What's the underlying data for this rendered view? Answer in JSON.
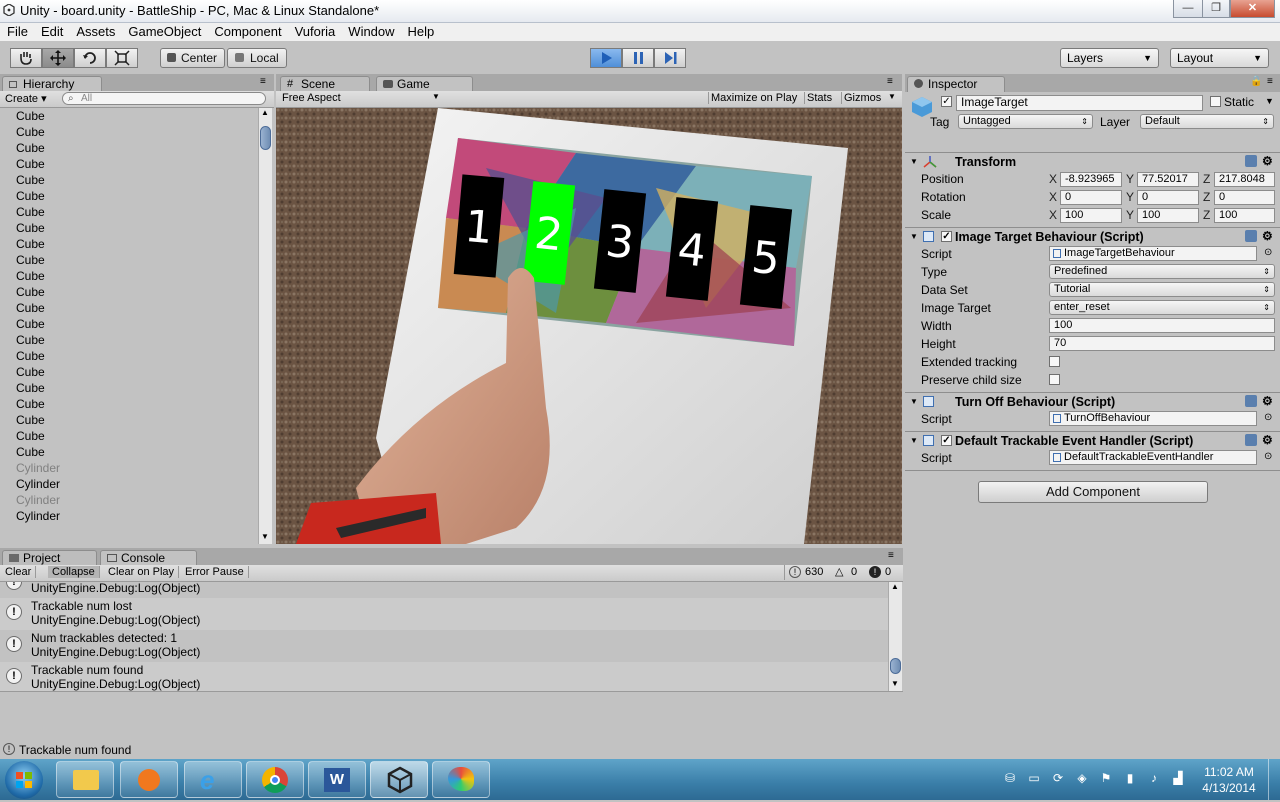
{
  "window": {
    "title": "Unity - board.unity - BattleShip - PC, Mac & Linux Standalone*",
    "min": "—",
    "max": "❐",
    "close": "✕"
  },
  "menu": [
    "File",
    "Edit",
    "Assets",
    "GameObject",
    "Component",
    "Vuforia",
    "Window",
    "Help"
  ],
  "toolbar": {
    "pivot": "Center",
    "space": "Local",
    "layers": "Layers",
    "layout": "Layout"
  },
  "hierarchy": {
    "tab": "Hierarchy",
    "create": "Create",
    "search_placeholder": "All",
    "items": [
      {
        "name": "Cube",
        "muted": false
      },
      {
        "name": "Cube",
        "muted": false
      },
      {
        "name": "Cube",
        "muted": false
      },
      {
        "name": "Cube",
        "muted": false
      },
      {
        "name": "Cube",
        "muted": false
      },
      {
        "name": "Cube",
        "muted": false
      },
      {
        "name": "Cube",
        "muted": false
      },
      {
        "name": "Cube",
        "muted": false
      },
      {
        "name": "Cube",
        "muted": false
      },
      {
        "name": "Cube",
        "muted": false
      },
      {
        "name": "Cube",
        "muted": false
      },
      {
        "name": "Cube",
        "muted": false
      },
      {
        "name": "Cube",
        "muted": false
      },
      {
        "name": "Cube",
        "muted": false
      },
      {
        "name": "Cube",
        "muted": false
      },
      {
        "name": "Cube",
        "muted": false
      },
      {
        "name": "Cube",
        "muted": false
      },
      {
        "name": "Cube",
        "muted": false
      },
      {
        "name": "Cube",
        "muted": false
      },
      {
        "name": "Cube",
        "muted": false
      },
      {
        "name": "Cube",
        "muted": false
      },
      {
        "name": "Cube",
        "muted": false
      },
      {
        "name": "Cylinder",
        "muted": true
      },
      {
        "name": "Cylinder",
        "muted": false
      },
      {
        "name": "Cylinder",
        "muted": true
      },
      {
        "name": "Cylinder",
        "muted": false
      }
    ]
  },
  "scene_tab": "Scene",
  "game": {
    "tab": "Game",
    "aspect": "Free Aspect",
    "maximize": "Maximize on Play",
    "stats": "Stats",
    "gizmos": "Gizmos",
    "buttons": [
      {
        "label": "1",
        "color": "#000000",
        "text_color": "#ffffff"
      },
      {
        "label": "2",
        "color": "#00ff00",
        "text_color": "#ffffff"
      },
      {
        "label": "3",
        "color": "#000000",
        "text_color": "#ffffff"
      },
      {
        "label": "4",
        "color": "#000000",
        "text_color": "#ffffff"
      },
      {
        "label": "5",
        "color": "#000000",
        "text_color": "#ffffff"
      }
    ]
  },
  "inspector": {
    "tab": "Inspector",
    "object_name": "ImageTarget",
    "static_label": "Static",
    "tag_label": "Tag",
    "tag_value": "Untagged",
    "layer_label": "Layer",
    "layer_value": "Default",
    "transform": {
      "title": "Transform",
      "position_label": "Position",
      "position": [
        "-8.923965",
        "77.52017",
        "217.8048"
      ],
      "rotation_label": "Rotation",
      "rotation": [
        "0",
        "0",
        "0"
      ],
      "scale_label": "Scale",
      "scale": [
        "100",
        "100",
        "100"
      ]
    },
    "image_target": {
      "title": "Image Target Behaviour (Script)",
      "script_label": "Script",
      "script": "ImageTargetBehaviour",
      "type_label": "Type",
      "type": "Predefined",
      "dataset_label": "Data Set",
      "dataset": "Tutorial",
      "image_target_label": "Image Target",
      "image_target": "enter_reset",
      "width_label": "Width",
      "width": "100",
      "height_label": "Height",
      "height": "70",
      "extended_label": "Extended tracking",
      "preserve_label": "Preserve child size"
    },
    "turn_off": {
      "title": "Turn Off Behaviour (Script)",
      "script_label": "Script",
      "script": "TurnOffBehaviour"
    },
    "trackable": {
      "title": "Default Trackable Event Handler (Script)",
      "script_label": "Script",
      "script": "DefaultTrackableEventHandler"
    },
    "add_component": "Add Component"
  },
  "console": {
    "project_tab": "Project",
    "tab": "Console",
    "clear": "Clear",
    "collapse": "Collapse",
    "clear_on_play": "Clear on Play",
    "error_pause": "Error Pause",
    "log_count": "630",
    "warn_count": "0",
    "error_count": "0",
    "entries": [
      {
        "line1": "",
        "line2": "UnityEngine.Debug:Log(Object)"
      },
      {
        "line1": "Trackable num lost",
        "line2": "UnityEngine.Debug:Log(Object)"
      },
      {
        "line1": "Num trackables detected: 1",
        "line2": "UnityEngine.Debug:Log(Object)"
      },
      {
        "line1": "Trackable num found",
        "line2": "UnityEngine.Debug:Log(Object)"
      }
    ]
  },
  "status": "Trackable num found",
  "taskbar": {
    "time": "11:02 AM",
    "date": "4/13/2014"
  }
}
